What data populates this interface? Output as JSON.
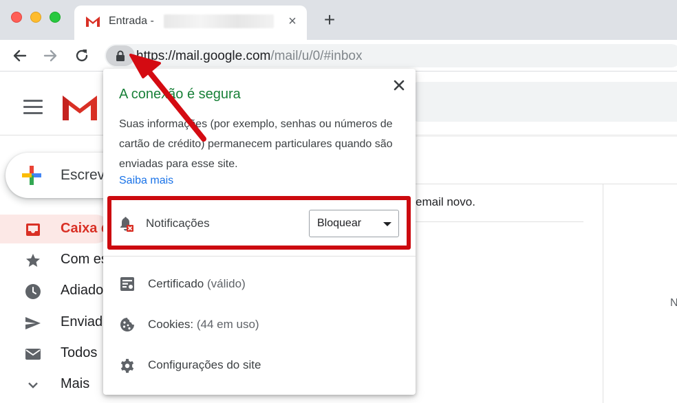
{
  "browser": {
    "tab_title": "Entrada -",
    "tab_close": "×",
    "new_tab": "+",
    "url_host": "https://mail.google.com",
    "url_path": "/mail/u/0/#inbox"
  },
  "gmail": {
    "compose_label": "Escrev",
    "sidebar": [
      {
        "label": "Caixa d",
        "icon": "inbox-icon",
        "active": true
      },
      {
        "label": "Com es",
        "icon": "star-icon"
      },
      {
        "label": "Adiado",
        "icon": "clock-icon"
      },
      {
        "label": "Enviad",
        "icon": "send-icon"
      },
      {
        "label": "Todos",
        "icon": "mail-icon"
      },
      {
        "label": "Mais",
        "icon": "chevron-down-icon"
      }
    ],
    "main_text": "email novo.",
    "right_letter": "N"
  },
  "popup": {
    "title": "A conexão é segura",
    "description": "Suas informações (por exemplo, senhas ou números de cartão de crédito) permanecem particulares quando são enviadas para esse site.",
    "learn_more": "Saiba mais",
    "notifications_label": "Notificações",
    "notifications_value": "Bloquear",
    "certificate_label": "Certificado",
    "certificate_status": "(válido)",
    "cookies_label": "Cookies:",
    "cookies_status": "(44 em uso)",
    "site_settings_label": "Configurações do site"
  },
  "colors": {
    "secure_green": "#188038",
    "highlight_red": "#cc0a0f",
    "link_blue": "#1a73e8",
    "gmail_red": "#d93025"
  }
}
